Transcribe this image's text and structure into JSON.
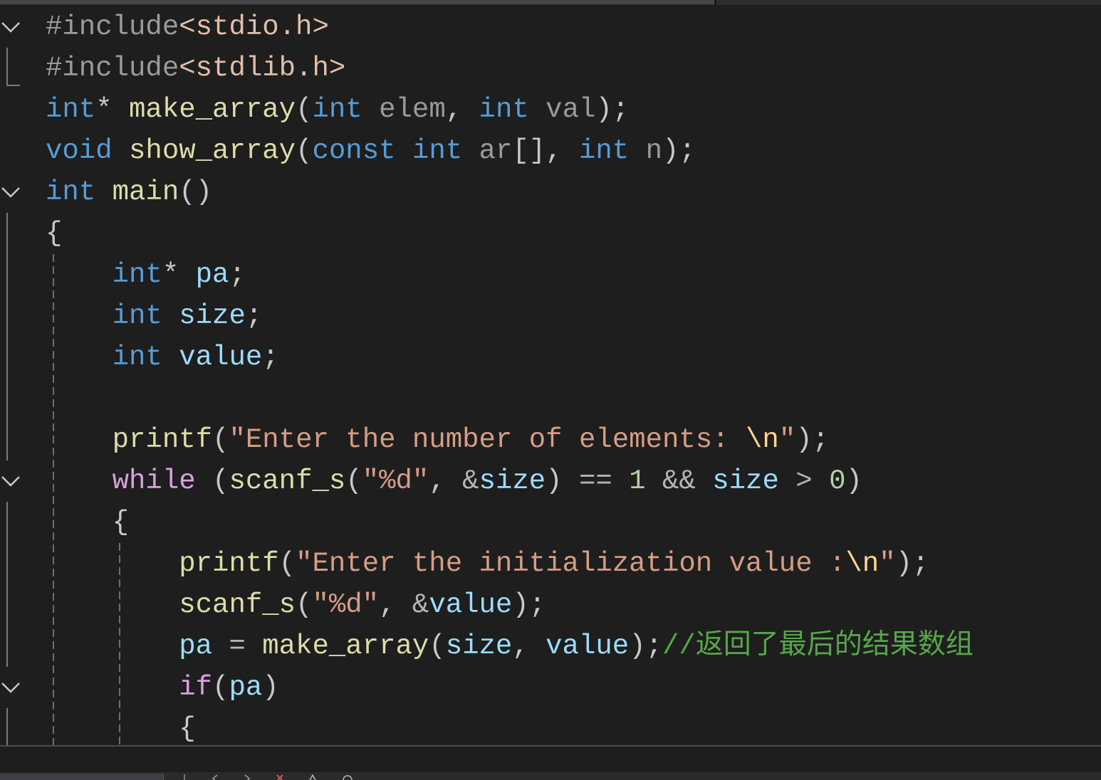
{
  "syntax_colors": {
    "preprocessor": "#9b9b9b",
    "include_path": "#e1bfa8",
    "keyword": "#569cd6",
    "control": "#d8a0df",
    "function": "#dcdcaa",
    "param": "#9a9a9a",
    "local": "#9cdcfe",
    "string": "#d69d85",
    "escape": "#ffd68f",
    "number": "#b5cea8",
    "operator": "#b4b4b4",
    "punct": "#c8c8c8",
    "comment": "#57a64a",
    "space": "#dcdcdc"
  },
  "editor": {
    "background": "#1e1e1e",
    "lines": [
      {
        "gutter_icon": "chevron-down-icon",
        "tokens": [
          {
            "preprocessor": "#include"
          },
          {
            "include_path": "<stdio.h>"
          }
        ]
      },
      {
        "gutter_icon": "fold-end-icon",
        "tokens": [
          {
            "preprocessor": "#include"
          },
          {
            "include_path": "<stdlib.h>"
          }
        ]
      },
      {
        "tokens": [
          {
            "keyword": "int"
          },
          {
            "punct": "* "
          },
          {
            "function": "make_array"
          },
          {
            "punct": "("
          },
          {
            "keyword": "int"
          },
          {
            "space": " "
          },
          {
            "param": "elem"
          },
          {
            "punct": ", "
          },
          {
            "keyword": "int"
          },
          {
            "space": " "
          },
          {
            "param": "val"
          },
          {
            "punct": ");"
          }
        ]
      },
      {
        "tokens": [
          {
            "keyword": "void"
          },
          {
            "space": " "
          },
          {
            "function": "show_array"
          },
          {
            "punct": "("
          },
          {
            "keyword": "const"
          },
          {
            "space": " "
          },
          {
            "keyword": "int"
          },
          {
            "space": " "
          },
          {
            "param": "ar"
          },
          {
            "punct": "[], "
          },
          {
            "keyword": "int"
          },
          {
            "space": " "
          },
          {
            "param": "n"
          },
          {
            "punct": ");"
          }
        ]
      },
      {
        "gutter_icon": "chevron-down-icon",
        "tokens": [
          {
            "keyword": "int"
          },
          {
            "space": " "
          },
          {
            "function": "main"
          },
          {
            "punct": "()"
          }
        ]
      },
      {
        "gutter_icon": "fold-line-icon",
        "tokens": [
          {
            "punct": "{"
          }
        ]
      },
      {
        "gutter_icon": "fold-line-icon",
        "tokens": [
          {
            "space": "    "
          },
          {
            "keyword": "int"
          },
          {
            "punct": "* "
          },
          {
            "local": "pa"
          },
          {
            "punct": ";"
          }
        ]
      },
      {
        "gutter_icon": "fold-line-icon",
        "tokens": [
          {
            "space": "    "
          },
          {
            "keyword": "int"
          },
          {
            "space": " "
          },
          {
            "local": "size"
          },
          {
            "punct": ";"
          }
        ]
      },
      {
        "gutter_icon": "fold-line-icon",
        "tokens": [
          {
            "space": "    "
          },
          {
            "keyword": "int"
          },
          {
            "space": " "
          },
          {
            "local": "value"
          },
          {
            "punct": ";"
          }
        ]
      },
      {
        "gutter_icon": "fold-line-icon",
        "tokens": []
      },
      {
        "gutter_icon": "fold-line-icon",
        "tokens": [
          {
            "space": "    "
          },
          {
            "function": "printf"
          },
          {
            "punct": "("
          },
          {
            "string": "\"Enter the number of elements: "
          },
          {
            "escape": "\\n"
          },
          {
            "string": "\""
          },
          {
            "punct": ");"
          }
        ]
      },
      {
        "gutter_icon": "chevron-down-icon",
        "tokens": [
          {
            "space": "    "
          },
          {
            "control": "while"
          },
          {
            "space": " "
          },
          {
            "punct": "("
          },
          {
            "function": "scanf_s"
          },
          {
            "punct": "("
          },
          {
            "string": "\"%d\""
          },
          {
            "punct": ", "
          },
          {
            "operator": "&"
          },
          {
            "local": "size"
          },
          {
            "punct": ") "
          },
          {
            "operator": "=="
          },
          {
            "space": " "
          },
          {
            "number": "1"
          },
          {
            "space": " "
          },
          {
            "operator": "&&"
          },
          {
            "space": " "
          },
          {
            "local": "size"
          },
          {
            "space": " "
          },
          {
            "operator": ">"
          },
          {
            "space": " "
          },
          {
            "number": "0"
          },
          {
            "punct": ")"
          }
        ]
      },
      {
        "gutter_icon": "fold-line-icon",
        "tokens": [
          {
            "space": "    "
          },
          {
            "punct": "{"
          }
        ]
      },
      {
        "gutter_icon": "fold-line-icon",
        "tokens": [
          {
            "space": "        "
          },
          {
            "function": "printf"
          },
          {
            "punct": "("
          },
          {
            "string": "\"Enter the initialization value :"
          },
          {
            "escape": "\\n"
          },
          {
            "string": "\""
          },
          {
            "punct": ");"
          }
        ]
      },
      {
        "gutter_icon": "fold-line-icon",
        "tokens": [
          {
            "space": "        "
          },
          {
            "function": "scanf_s"
          },
          {
            "punct": "("
          },
          {
            "string": "\"%d\""
          },
          {
            "punct": ", "
          },
          {
            "operator": "&"
          },
          {
            "local": "value"
          },
          {
            "punct": ");"
          }
        ]
      },
      {
        "gutter_icon": "fold-line-icon",
        "tokens": [
          {
            "space": "        "
          },
          {
            "local": "pa"
          },
          {
            "space": " "
          },
          {
            "operator": "="
          },
          {
            "space": " "
          },
          {
            "function": "make_array"
          },
          {
            "punct": "("
          },
          {
            "local": "size"
          },
          {
            "punct": ", "
          },
          {
            "local": "value"
          },
          {
            "punct": ");"
          },
          {
            "comment": "//返回了最后的结果数组"
          }
        ]
      },
      {
        "gutter_icon": "chevron-down-icon",
        "tokens": [
          {
            "space": "        "
          },
          {
            "control": "if"
          },
          {
            "punct": "("
          },
          {
            "local": "pa"
          },
          {
            "punct": ")"
          }
        ]
      },
      {
        "gutter_icon": "fold-line-icon",
        "tokens": [
          {
            "space": "        "
          },
          {
            "punct": "{"
          }
        ]
      }
    ]
  },
  "status_bar": {
    "icons": [
      "back-arrow-icon",
      "forward-arrow-icon",
      "error-icon",
      "warning-icon",
      "circle-icon"
    ],
    "error_color": "#e05252"
  }
}
